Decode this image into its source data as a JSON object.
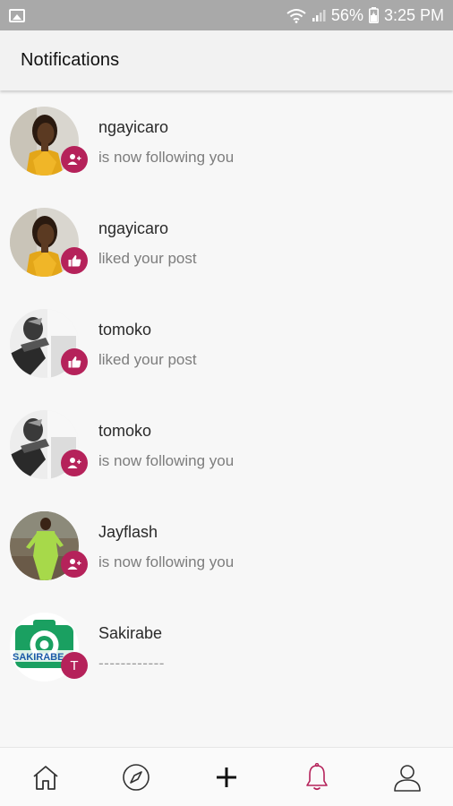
{
  "status_bar": {
    "battery": "56%",
    "time": "3:25 PM",
    "icons": [
      "image-icon",
      "wifi-icon",
      "signal-icon",
      "battery-icon"
    ]
  },
  "header": {
    "title": "Notifications"
  },
  "notifications": [
    {
      "user": "ngayicaro",
      "action": "is now following you",
      "badge": "follow-icon",
      "avatar": "woman-yellow-photo"
    },
    {
      "user": "ngayicaro",
      "action": "liked your post",
      "badge": "like-icon",
      "avatar": "woman-yellow-photo"
    },
    {
      "user": "tomoko",
      "action": "liked your post",
      "badge": "like-icon",
      "avatar": "bw-photo"
    },
    {
      "user": "tomoko",
      "action": "is now following you",
      "badge": "follow-icon",
      "avatar": "bw-photo"
    },
    {
      "user": "Jayflash",
      "action": "is now following you",
      "badge": "follow-icon",
      "avatar": "green-outfit-photo"
    },
    {
      "user": "Sakirabe",
      "action": "------------",
      "badge": "T",
      "avatar": "sakirabe-logo",
      "avatar_text": "SAKIRABE"
    }
  ],
  "bottom_nav": {
    "items": [
      "home-icon",
      "compass-icon",
      "plus-icon",
      "bell-icon",
      "profile-icon"
    ],
    "active": "bell-icon"
  },
  "colors": {
    "accent": "#b5225a",
    "status_bar": "#a9a9a9",
    "background": "#f7f7f7"
  }
}
